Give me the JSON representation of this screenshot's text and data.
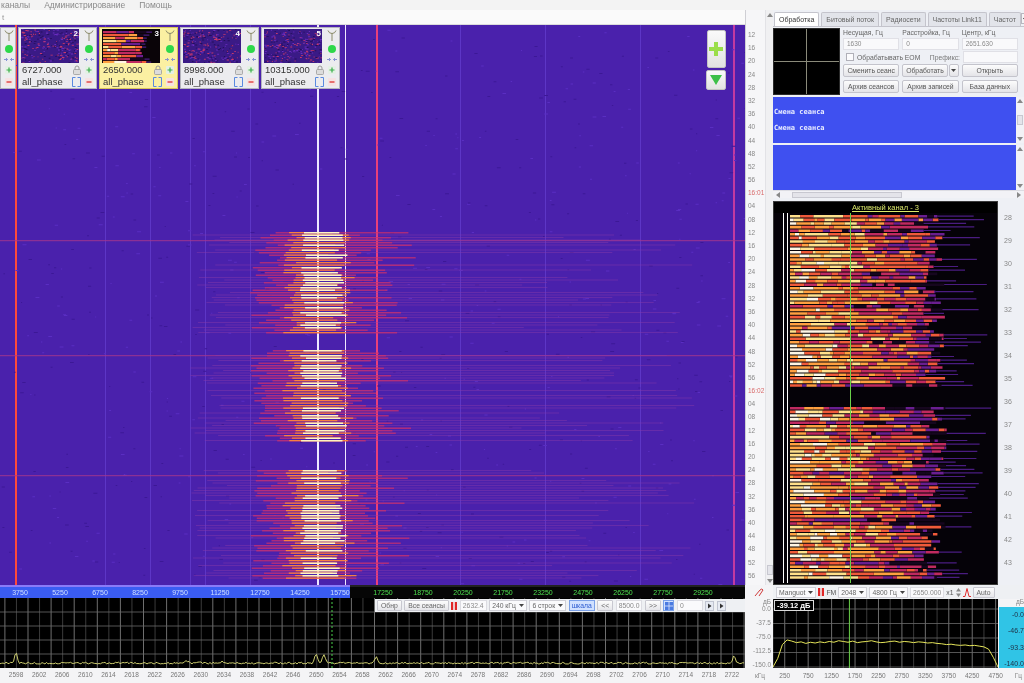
{
  "menu": [
    {
      "label": "каналы"
    },
    {
      "label": "Администрирование"
    },
    {
      "label": "Помощь"
    }
  ],
  "toolbar": {
    "label": "t"
  },
  "channels": [
    {
      "kind": "partial",
      "selected": false,
      "active": true
    },
    {
      "kind": "full",
      "number": "2",
      "frequency": "6727.000",
      "mode": "all_phase",
      "selected": false,
      "active": true,
      "signal": false
    },
    {
      "kind": "full",
      "number": "3",
      "frequency": "2650.000",
      "mode": "all_phase",
      "selected": true,
      "active": true,
      "signal": true
    },
    {
      "kind": "full",
      "number": "4",
      "frequency": "8998.000",
      "mode": "all_phase",
      "selected": false,
      "active": true,
      "signal": false
    },
    {
      "kind": "full",
      "number": "5",
      "frequency": "10315.000",
      "mode": "all_phase",
      "selected": false,
      "active": true,
      "signal": false
    }
  ],
  "time_axis": [
    {
      "text": "12",
      "kind": "second"
    },
    {
      "text": "16",
      "kind": "second"
    },
    {
      "text": "20",
      "kind": "second"
    },
    {
      "text": "24",
      "kind": "second"
    },
    {
      "text": "28",
      "kind": "second"
    },
    {
      "text": "32",
      "kind": "second"
    },
    {
      "text": "36",
      "kind": "second"
    },
    {
      "text": "40",
      "kind": "second"
    },
    {
      "text": "44",
      "kind": "second"
    },
    {
      "text": "48",
      "kind": "second"
    },
    {
      "text": "52",
      "kind": "second"
    },
    {
      "text": "56",
      "kind": "second"
    },
    {
      "text": "16:01",
      "kind": "minute"
    },
    {
      "text": "04",
      "kind": "second"
    },
    {
      "text": "08",
      "kind": "second"
    },
    {
      "text": "12",
      "kind": "second"
    },
    {
      "text": "16",
      "kind": "second"
    },
    {
      "text": "20",
      "kind": "second"
    },
    {
      "text": "24",
      "kind": "second"
    },
    {
      "text": "28",
      "kind": "second"
    },
    {
      "text": "32",
      "kind": "second"
    },
    {
      "text": "36",
      "kind": "second"
    },
    {
      "text": "40",
      "kind": "second"
    },
    {
      "text": "44",
      "kind": "second"
    },
    {
      "text": "48",
      "kind": "second"
    },
    {
      "text": "52",
      "kind": "second"
    },
    {
      "text": "56",
      "kind": "second"
    },
    {
      "text": "16:02",
      "kind": "minute"
    },
    {
      "text": "04",
      "kind": "second"
    },
    {
      "text": "08",
      "kind": "second"
    },
    {
      "text": "12",
      "kind": "second"
    },
    {
      "text": "16",
      "kind": "second"
    },
    {
      "text": "20",
      "kind": "second"
    },
    {
      "text": "24",
      "kind": "second"
    },
    {
      "text": "28",
      "kind": "second"
    },
    {
      "text": "32",
      "kind": "second"
    },
    {
      "text": "36",
      "kind": "second"
    },
    {
      "text": "40",
      "kind": "second"
    },
    {
      "text": "44",
      "kind": "second"
    },
    {
      "text": "48",
      "kind": "second"
    },
    {
      "text": "52",
      "kind": "second"
    },
    {
      "text": "56",
      "kind": "second"
    }
  ],
  "tabs": [
    {
      "label": "Обработка",
      "selected": true
    },
    {
      "label": "Битовый поток",
      "selected": false
    },
    {
      "label": "Радиосети",
      "selected": false
    },
    {
      "label": "Частоты Link11",
      "selected": false
    },
    {
      "label": "Частот",
      "selected": false
    }
  ],
  "processing": {
    "fields": [
      {
        "label": "Несущая, Гц",
        "value": "1630"
      },
      {
        "label": "Расстройка, Гц",
        "value": "0"
      },
      {
        "label": "Центр, кГц",
        "value": "2651.630"
      }
    ],
    "eom": {
      "label": "Обрабатывать ЕОМ",
      "checked": false
    },
    "prefix_label": "Префикс:",
    "buttons": [
      [
        {
          "label": "Сменить сеанс",
          "kind": "plain"
        },
        {
          "label": "Обработать",
          "kind": "split"
        },
        {
          "label": "Открыть",
          "kind": "plain"
        }
      ],
      [
        {
          "label": "Архив сеансов",
          "kind": "plain"
        },
        {
          "label": "Архив записей",
          "kind": "plain"
        },
        {
          "label": "База данных",
          "kind": "plain"
        }
      ]
    ]
  },
  "log": [
    "Смена сеанса",
    "Смена сеанса"
  ],
  "active_channel": {
    "title": "Активный канал - 3",
    "minute_axis": [
      "28",
      "29",
      "30",
      "31",
      "32",
      "33",
      "34",
      "35",
      "36",
      "37",
      "38",
      "39",
      "40",
      "41",
      "42",
      "43"
    ]
  },
  "frequency_scale": [
    {
      "kind": "in_view",
      "labels": [
        "3750",
        "5250",
        "6750",
        "8250",
        "9750",
        "11250",
        "12750",
        "14250",
        "15750"
      ]
    },
    {
      "kind": "out_of_view",
      "labels": [
        "17250",
        "18750",
        "20250",
        "21750",
        "23250",
        "24750",
        "26250",
        "27750",
        "29250"
      ]
    }
  ],
  "spectrum_toolbar": [
    {
      "kind": "button",
      "label": "Обнр"
    },
    {
      "kind": "button",
      "label": "Все сеансы"
    },
    {
      "kind": "pause"
    },
    {
      "kind": "field",
      "value": "2632.4"
    },
    {
      "kind": "dropdown",
      "value": "240 кГц"
    },
    {
      "kind": "dropdown",
      "value": "6 строк"
    },
    {
      "kind": "toggle",
      "label": "шкала",
      "selected": true
    },
    {
      "kind": "button",
      "label": "<<"
    },
    {
      "kind": "field",
      "value": "8500.0"
    },
    {
      "kind": "button",
      "label": ">>"
    },
    {
      "kind": "icon_toggle",
      "selected": true
    },
    {
      "kind": "field",
      "value": "0"
    },
    {
      "kind": "step"
    },
    {
      "kind": "step"
    }
  ],
  "spectrum": {
    "unit": "кГц",
    "axis_labels": [
      "2598",
      "2602",
      "2606",
      "2610",
      "2614",
      "2618",
      "2622",
      "2626",
      "2630",
      "2634",
      "2638",
      "2642",
      "2646",
      "2650",
      "2654",
      "2658",
      "2662",
      "2666",
      "2670",
      "2674",
      "2678",
      "2682",
      "2686",
      "2690",
      "2694",
      "2698",
      "2702",
      "2706",
      "2710",
      "2714",
      "2718",
      "2722"
    ]
  },
  "channel_toolbar": [
    {
      "kind": "dropdown",
      "value": "Manguot"
    },
    {
      "kind": "pause"
    },
    {
      "kind": "label",
      "label": "FM"
    },
    {
      "kind": "dropdown",
      "value": "2048"
    },
    {
      "kind": "dropdown",
      "value": "4800 Гц"
    },
    {
      "kind": "field",
      "value": "2650.000"
    },
    {
      "kind": "label",
      "label": "x1"
    },
    {
      "kind": "spinner"
    },
    {
      "kind": "marker"
    },
    {
      "kind": "button",
      "label": "Auto"
    }
  ],
  "channel_spectrum": {
    "readout": "-39.12 дБ",
    "chart_data": {
      "type": "line",
      "xlabel": "Гц",
      "ylabel": "дБ",
      "x": [
        0,
        100,
        200,
        300,
        400,
        500,
        600,
        700,
        800,
        900,
        1000,
        1100,
        1200,
        1300,
        1400,
        1500,
        1600,
        1700,
        1800,
        1900,
        2000,
        2100,
        2200,
        2300,
        2400,
        2500,
        2600,
        2700,
        2800,
        2900,
        3000,
        3100,
        3200,
        3300,
        3400,
        3500,
        3600,
        3700,
        3800,
        3900,
        4000,
        4100,
        4200,
        4300,
        4400,
        4500,
        4600,
        4700,
        4800
      ],
      "series": [
        {
          "color": "#e6e65a",
          "values": [
            -150,
            -128,
            -92,
            -80,
            -83,
            -87,
            -85,
            -89,
            -86,
            -88,
            -85,
            -87,
            -84,
            -86,
            -82,
            -84,
            -86,
            -83,
            -87,
            -85,
            -84,
            -82,
            -85,
            -87,
            -86,
            -84,
            -83,
            -86,
            -84,
            -85,
            -87,
            -85,
            -86,
            -88,
            -87,
            -89,
            -90,
            -92,
            -91,
            -93,
            -94,
            -93,
            -95,
            -94,
            -96,
            -98,
            -104,
            -125,
            -150
          ]
        }
      ],
      "xlim": [
        0,
        4800
      ],
      "ylim": [
        -150,
        0
      ],
      "xticks": [
        250,
        750,
        1250,
        1750,
        2250,
        2750,
        3250,
        3750,
        4250,
        4750
      ],
      "yticks": [
        {
          "value": 0,
          "label": "0.0"
        },
        {
          "value": -37.5,
          "label": "-37.5"
        },
        {
          "value": -75,
          "label": "-75.0"
        },
        {
          "value": -112.5,
          "label": "-112.5"
        },
        {
          "value": -150,
          "label": "-150.0"
        }
      ],
      "grid": true,
      "ref_lines": [
        {
          "axis": "x",
          "value": 1630,
          "color": "#6ad04a"
        }
      ]
    }
  },
  "level_scale": {
    "unit": "дБ",
    "labels": [
      "-0.0",
      "-46.7",
      "-93.3",
      "-140.0"
    ]
  }
}
